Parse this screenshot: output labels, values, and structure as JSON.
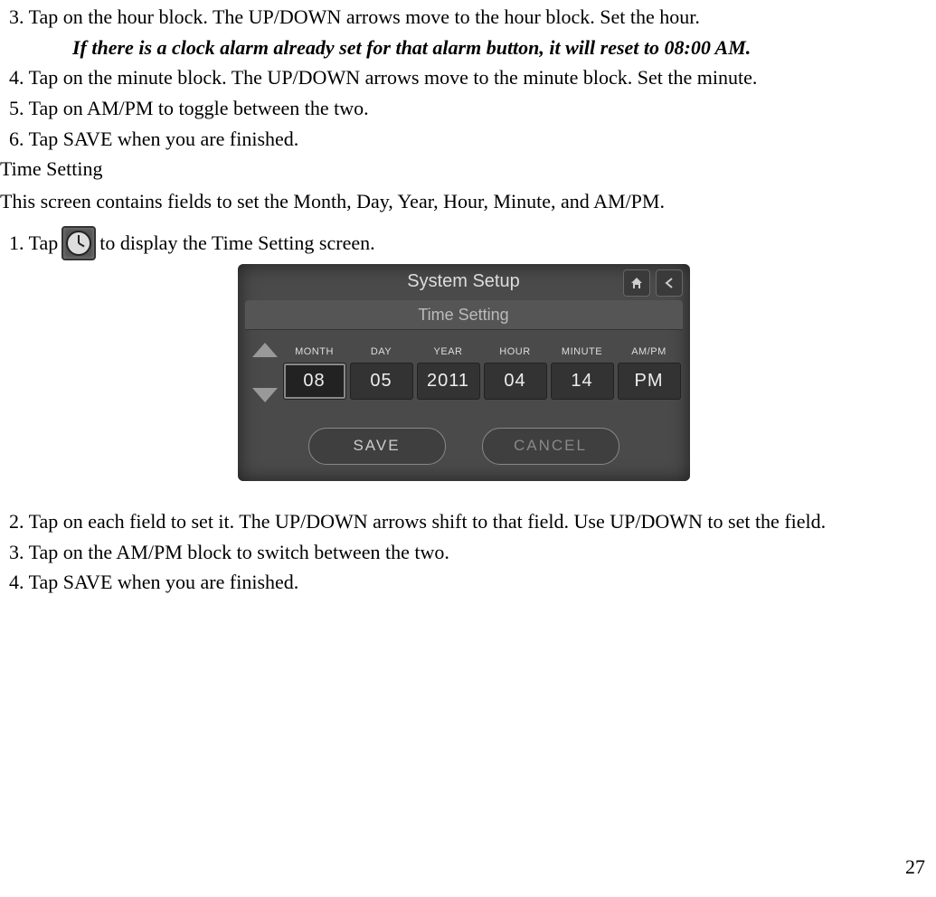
{
  "steps_top": {
    "s3": "3. Tap on the hour block. The UP/DOWN arrows move to the hour block. Set the hour.",
    "note": "If there is a clock alarm already set for that alarm button, it will reset to 08:00 AM.",
    "s4": "4. Tap on the minute block. The UP/DOWN arrows move to the minute block. Set the minute.",
    "s5": "5. Tap on AM/PM to toggle between the two.",
    "s6": "6. Tap SAVE when you are finished."
  },
  "section": {
    "heading": "Time Setting",
    "intro": "This screen contains fields to set the Month, Day, Year, Hour, Minute, and AM/PM.",
    "step1_prefix": "1. Tap",
    "step1_suffix": "to display the Time Setting screen.",
    "step2": "2. Tap on each field to set it. The UP/DOWN arrows shift to that field. Use UP/DOWN to set the field.",
    "step3": "3. Tap on the AM/PM block to switch between the two.",
    "step4": "4. Tap SAVE when you are finished."
  },
  "device": {
    "title": "System Setup",
    "subtitle": "Time Setting",
    "fields": [
      {
        "label": "MONTH",
        "value": "08",
        "selected": true
      },
      {
        "label": "DAY",
        "value": "05",
        "selected": false
      },
      {
        "label": "YEAR",
        "value": "2011",
        "selected": false
      },
      {
        "label": "HOUR",
        "value": "04",
        "selected": false
      },
      {
        "label": "MINUTE",
        "value": "14",
        "selected": false
      },
      {
        "label": "AM/PM",
        "value": "PM",
        "selected": false
      }
    ],
    "save_label": "SAVE",
    "cancel_label": "CANCEL"
  },
  "page_number": "27"
}
